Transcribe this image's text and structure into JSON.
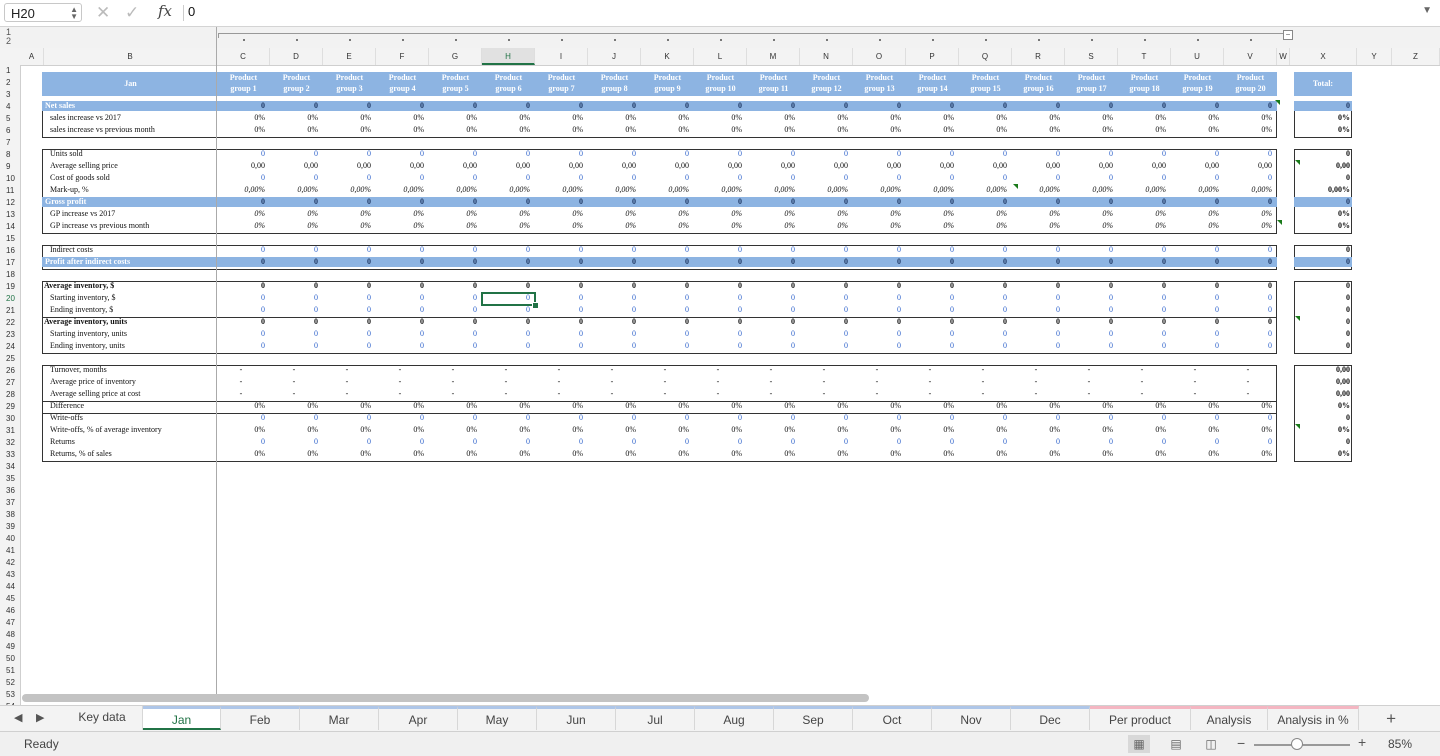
{
  "formula_bar": {
    "name_box": "H20",
    "fx_label": "fx",
    "value": "0"
  },
  "outline_levels": [
    "1",
    "2"
  ],
  "columns": [
    "A",
    "B",
    "C",
    "D",
    "E",
    "F",
    "G",
    "H",
    "I",
    "J",
    "K",
    "L",
    "M",
    "N",
    "O",
    "P",
    "Q",
    "R",
    "S",
    "T",
    "U",
    "V",
    "W",
    "X",
    "Y",
    "Z"
  ],
  "selected_column": "H",
  "selected_row": 20,
  "rows": [
    "1",
    "2",
    "3",
    "4",
    "5",
    "6",
    "7",
    "8",
    "9",
    "10",
    "11",
    "12",
    "13",
    "14",
    "15",
    "16",
    "17",
    "18",
    "19",
    "20",
    "21",
    "22",
    "23",
    "24",
    "25",
    "26",
    "27",
    "28",
    "29",
    "30",
    "31",
    "32",
    "33",
    "34",
    "35",
    "36",
    "37",
    "38",
    "39",
    "40",
    "41",
    "42",
    "43",
    "44",
    "45",
    "46",
    "47",
    "48",
    "49",
    "50",
    "51",
    "52",
    "53",
    "54",
    "55"
  ],
  "sheet": {
    "month_title": "Jan",
    "total_label": "Total:",
    "product_groups": [
      [
        "Product",
        "group 1"
      ],
      [
        "Product",
        "group 2"
      ],
      [
        "Product",
        "group 3"
      ],
      [
        "Product",
        "group 4"
      ],
      [
        "Product",
        "group 5"
      ],
      [
        "Product",
        "group 6"
      ],
      [
        "Product",
        "group 7"
      ],
      [
        "Product",
        "group 8"
      ],
      [
        "Product",
        "group 9"
      ],
      [
        "Product",
        "group 10"
      ],
      [
        "Product",
        "group 11"
      ],
      [
        "Product",
        "group 12"
      ],
      [
        "Product",
        "group 13"
      ],
      [
        "Product",
        "group 14"
      ],
      [
        "Product",
        "group 15"
      ],
      [
        "Product",
        "group 16"
      ],
      [
        "Product",
        "group 17"
      ],
      [
        "Product",
        "group 18"
      ],
      [
        "Product",
        "group 19"
      ],
      [
        "Product",
        "group 20"
      ]
    ],
    "data_rows": [
      {
        "row": 4,
        "label": "Net sales",
        "value": "0",
        "total": "0",
        "style": "band"
      },
      {
        "row": 5,
        "label": "sales increase vs 2017",
        "value": "0%",
        "total": "0%",
        "style": "black"
      },
      {
        "row": 6,
        "label": "sales increase vs previous month",
        "value": "0%",
        "total": "0%",
        "style": "black"
      },
      {
        "row": 8,
        "label": "Units sold",
        "value": "0",
        "total": "0",
        "style": "blue"
      },
      {
        "row": 9,
        "label": "Average selling price",
        "value": "0,00",
        "total": "0,00",
        "style": "black"
      },
      {
        "row": 10,
        "label": "Cost of goods sold",
        "value": "0",
        "total": "0",
        "style": "blue"
      },
      {
        "row": 11,
        "label": "Mark-up, %",
        "value": "0,00%",
        "total": "0,00%",
        "style": "italic"
      },
      {
        "row": 12,
        "label": "Gross profit",
        "value": "0",
        "total": "0",
        "style": "band"
      },
      {
        "row": 13,
        "label": "GP increase vs 2017",
        "value": "0%",
        "total": "0%",
        "style": "italic"
      },
      {
        "row": 14,
        "label": "GP increase vs previous month",
        "value": "0%",
        "total": "0%",
        "style": "italic"
      },
      {
        "row": 16,
        "label": "Indirect costs",
        "value": "0",
        "total": "0",
        "style": "blue"
      },
      {
        "row": 17,
        "label": "Profit after indirect costs",
        "value": "0",
        "total": "0",
        "style": "band"
      },
      {
        "row": 19,
        "label": "Average inventory, $",
        "value": "0",
        "total": "0",
        "style": "bold"
      },
      {
        "row": 20,
        "label": "Starting inventory, $",
        "value": "0",
        "total": "0",
        "style": "blue"
      },
      {
        "row": 21,
        "label": "Ending inventory, $",
        "value": "0",
        "total": "0",
        "style": "blue"
      },
      {
        "row": 22,
        "label": "Average inventory, units",
        "value": "0",
        "total": "0",
        "style": "bold"
      },
      {
        "row": 23,
        "label": "Starting inventory, units",
        "value": "0",
        "total": "0",
        "style": "blue"
      },
      {
        "row": 24,
        "label": "Ending inventory, units",
        "value": "0",
        "total": "0",
        "style": "blue"
      },
      {
        "row": 26,
        "label": "Turnover, months",
        "value": "-",
        "total": "0,00",
        "style": "black"
      },
      {
        "row": 27,
        "label": "Average price of inventory",
        "value": "-",
        "total": "0,00",
        "style": "black"
      },
      {
        "row": 28,
        "label": "Average selling price at cost",
        "value": "-",
        "total": "0,00",
        "style": "black"
      },
      {
        "row": 29,
        "label": "Difference",
        "value": "0%",
        "total": "0%",
        "style": "black"
      },
      {
        "row": 30,
        "label": "Write-offs",
        "value": "0",
        "total": "0",
        "style": "blue"
      },
      {
        "row": 31,
        "label": "Write-offs, % of average inventory",
        "value": "0%",
        "total": "0%",
        "style": "black"
      },
      {
        "row": 32,
        "label": "Returns",
        "value": "0",
        "total": "0",
        "style": "blue"
      },
      {
        "row": 33,
        "label": "Returns, % of sales",
        "value": "0%",
        "total": "0%",
        "style": "black"
      }
    ]
  },
  "tabs": [
    {
      "label": "Key data",
      "active": false,
      "accent": "none"
    },
    {
      "label": "Jan",
      "active": true,
      "accent": "blue"
    },
    {
      "label": "Feb",
      "active": false,
      "accent": "blue"
    },
    {
      "label": "Mar",
      "active": false,
      "accent": "blue"
    },
    {
      "label": "Apr",
      "active": false,
      "accent": "blue"
    },
    {
      "label": "May",
      "active": false,
      "accent": "blue"
    },
    {
      "label": "Jun",
      "active": false,
      "accent": "blue"
    },
    {
      "label": "Jul",
      "active": false,
      "accent": "blue"
    },
    {
      "label": "Aug",
      "active": false,
      "accent": "blue"
    },
    {
      "label": "Sep",
      "active": false,
      "accent": "blue"
    },
    {
      "label": "Oct",
      "active": false,
      "accent": "blue"
    },
    {
      "label": "Nov",
      "active": false,
      "accent": "blue"
    },
    {
      "label": "Dec",
      "active": false,
      "accent": "blue"
    },
    {
      "label": "Per product",
      "active": false,
      "accent": "red"
    },
    {
      "label": "Analysis",
      "active": false,
      "accent": "red"
    },
    {
      "label": "Analysis in %",
      "active": false,
      "accent": "red"
    }
  ],
  "status": {
    "text": "Ready",
    "zoom": "85%",
    "zoom_fraction": 0.45,
    "active_view": "normal"
  },
  "colors": {
    "header_band": "#8db4e2",
    "accent": "#217346",
    "input_blue": "#3366cc"
  }
}
